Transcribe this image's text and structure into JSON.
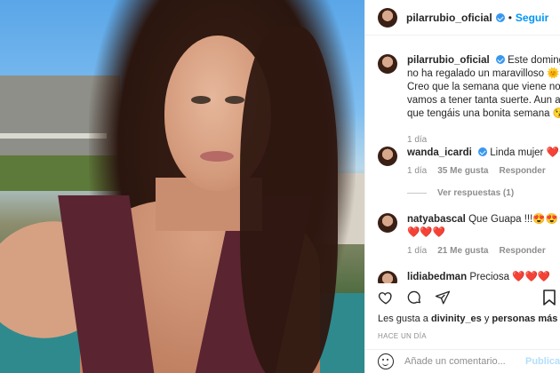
{
  "post": {
    "author": "pilarrubio_oficial",
    "follow_label": "Seguir",
    "dot": "•"
  },
  "caption": {
    "username": "pilarrubio_oficial",
    "text": "Este domingo no ha regalado un maravilloso 🌞. Creo que la semana que viene no vamos a tener tanta suerte. Aun así, que tengáis una bonita semana 😘",
    "time": "1 día"
  },
  "comments": [
    {
      "username": "wanda_icardi",
      "text": "Linda mujer ❤️",
      "time": "1 día",
      "likes": "35 Me gusta",
      "reply": "Responder",
      "view_replies": "Ver respuestas (1)"
    },
    {
      "username": "natyabascal",
      "text": "Que Guapa !!!😍😍 😍❤️❤️❤️",
      "time": "1 día",
      "likes": "21 Me gusta",
      "reply": "Responder"
    },
    {
      "username": "lidiabedman",
      "text": "Preciosa ❤️❤️❤️"
    }
  ],
  "likes_line": {
    "prefix": "Les gusta a ",
    "user": "divinity_es",
    "middle": " y ",
    "others": "personas más"
  },
  "timestamp": "HACE UN DÍA",
  "add_comment": {
    "placeholder": "Añade un comentario...",
    "publish": "Publicar"
  },
  "icons": [
    "heart-icon",
    "comment-icon",
    "share-icon",
    "bookmark-icon",
    "emoji-icon",
    "verified-icon"
  ],
  "colors": {
    "link_blue": "#0095f6",
    "verified_blue": "#3897f0",
    "muted": "#8e8e8e"
  }
}
